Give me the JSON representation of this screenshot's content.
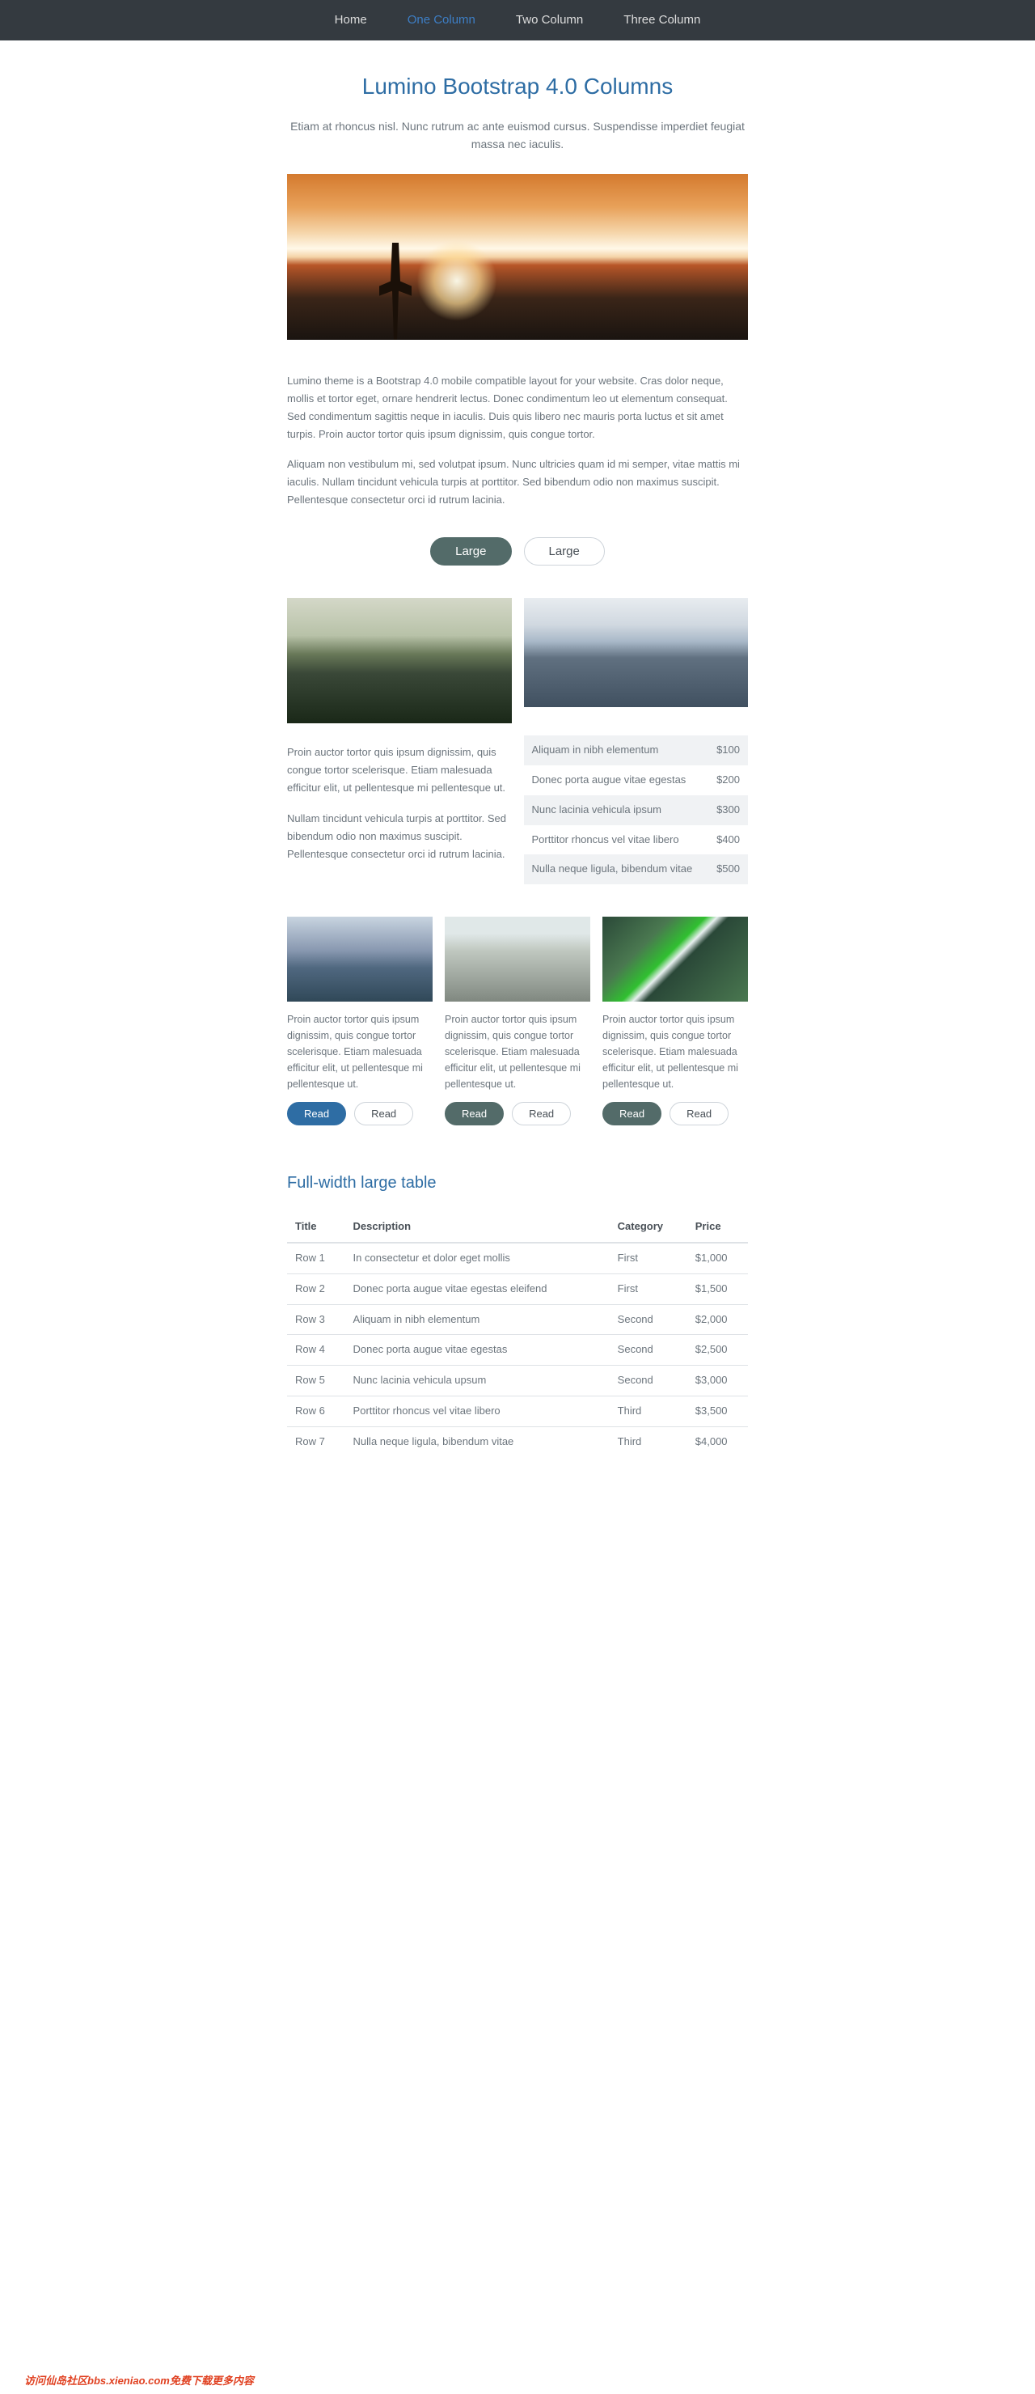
{
  "nav": [
    "Home",
    "One Column",
    "Two Column",
    "Three Column"
  ],
  "nav_active": 1,
  "header": {
    "title": "Lumino Bootstrap 4.0 Columns",
    "subtitle": "Etiam at rhoncus nisl. Nunc rutrum ac ante euismod cursus. Suspendisse imperdiet feugiat massa nec iaculis."
  },
  "intro": {
    "p1": "Lumino theme is a Bootstrap 4.0 mobile compatible layout for your website. Cras dolor neque, mollis et tortor eget, ornare hendrerit lectus. Donec condimentum leo ut elementum consequat. Sed condimentum sagittis neque in iaculis. Duis quis libero nec mauris porta luctus et sit amet turpis. Proin auctor tortor quis ipsum dignissim, quis congue tortor.",
    "p2": "Aliquam non vestibulum mi, sed volutpat ipsum. Nunc ultricies quam id mi semper, vitae mattis mi iaculis. Nullam tincidunt vehicula turpis at porttitor. Sed bibendum odio non maximus suscipit. Pellentesque consectetur orci id rutrum lacinia.",
    "btn1": "Large",
    "btn2": "Large"
  },
  "two_col": {
    "left_p1": "Proin auctor tortor quis ipsum dignissim, quis congue tortor scelerisque. Etiam malesuada efficitur elit, ut pellentesque mi pellentesque ut.",
    "left_p2": "Nullam tincidunt vehicula turpis at porttitor. Sed bibendum odio non maximus suscipit. Pellentesque consectetur orci id rutrum lacinia.",
    "table": [
      {
        "name": "Aliquam in nibh elementum",
        "price": "$100"
      },
      {
        "name": "Donec porta augue vitae egestas",
        "price": "$200"
      },
      {
        "name": "Nunc lacinia vehicula ipsum",
        "price": "$300"
      },
      {
        "name": "Porttitor rhoncus vel vitae libero",
        "price": "$400"
      },
      {
        "name": "Nulla neque ligula, bibendum vitae",
        "price": "$500"
      }
    ]
  },
  "cards": [
    {
      "text": "Proin auctor tortor quis ipsum dignissim, quis congue tortor scelerisque. Etiam malesuada efficitur elit, ut pellentesque mi pellentesque ut.",
      "b1": "Read",
      "b2": "Read"
    },
    {
      "text": "Proin auctor tortor quis ipsum dignissim, quis congue tortor scelerisque. Etiam malesuada efficitur elit, ut pellentesque mi pellentesque ut.",
      "b1": "Read",
      "b2": "Read"
    },
    {
      "text": "Proin auctor tortor quis ipsum dignissim, quis congue tortor scelerisque. Etiam malesuada efficitur elit, ut pellentesque mi pellentesque ut.",
      "b1": "Read",
      "b2": "Read"
    }
  ],
  "large_table": {
    "title": "Full-width large table",
    "headers": [
      "Title",
      "Description",
      "Category",
      "Price"
    ],
    "rows": [
      {
        "t": "Row 1",
        "d": "In consectetur et dolor eget mollis",
        "c": "First",
        "p": "$1,000"
      },
      {
        "t": "Row 2",
        "d": "Donec porta augue vitae egestas eleifend",
        "c": "First",
        "p": "$1,500"
      },
      {
        "t": "Row 3",
        "d": "Aliquam in nibh elementum",
        "c": "Second",
        "p": "$2,000"
      },
      {
        "t": "Row 4",
        "d": "Donec porta augue vitae egestas",
        "c": "Second",
        "p": "$2,500"
      },
      {
        "t": "Row 5",
        "d": "Nunc lacinia vehicula upsum",
        "c": "Second",
        "p": "$3,000"
      },
      {
        "t": "Row 6",
        "d": "Porttitor rhoncus vel vitae libero",
        "c": "Third",
        "p": "$3,500"
      },
      {
        "t": "Row 7",
        "d": "Nulla neque ligula, bibendum vitae",
        "c": "Third",
        "p": "$4,000"
      }
    ]
  },
  "watermark": "访问仙岛社区bbs.xieniao.com免费下载更多内容"
}
